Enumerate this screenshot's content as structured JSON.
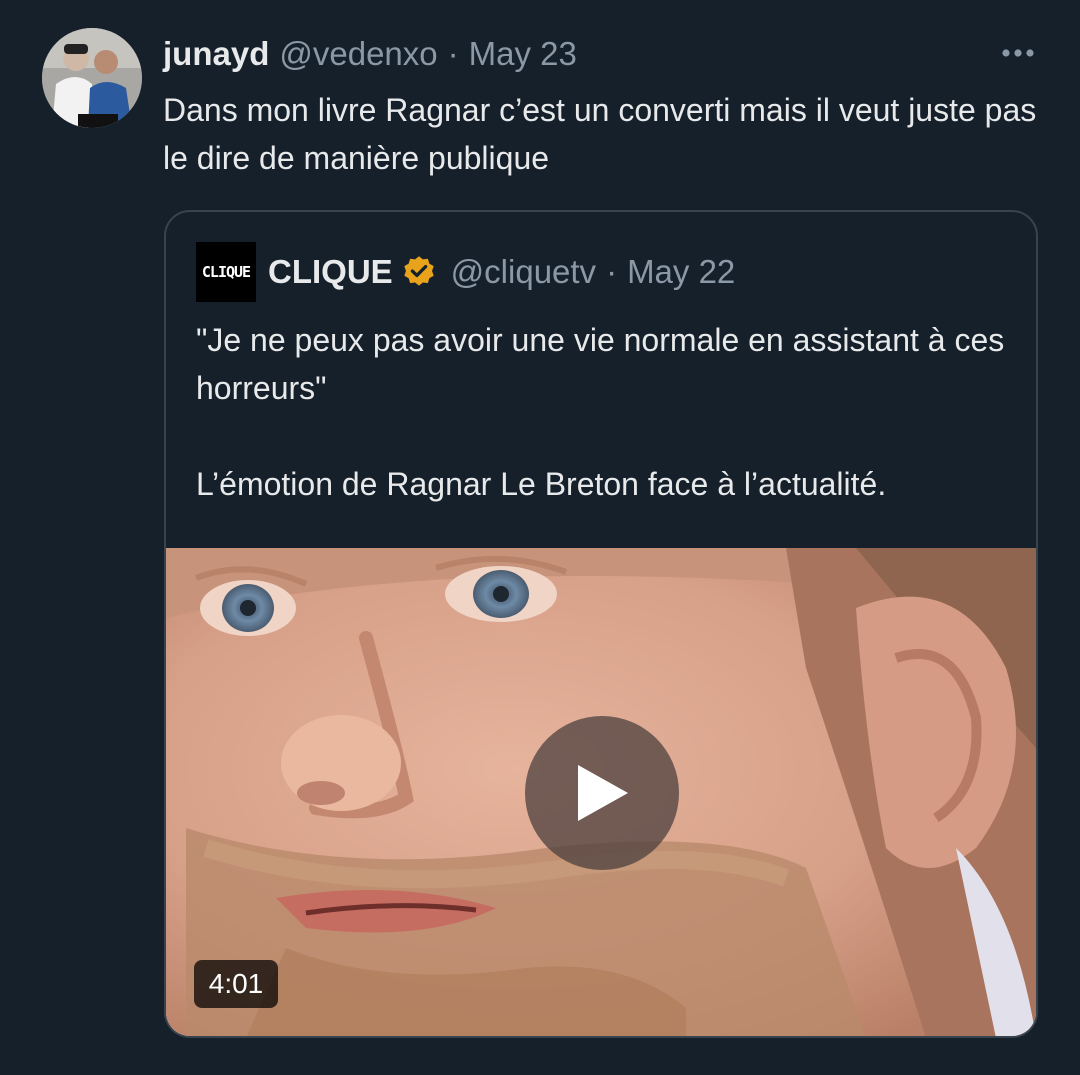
{
  "tweet": {
    "author_name": "junayd",
    "author_handle": "@vedenxo",
    "separator": "·",
    "date": "May 23",
    "text": "Dans mon livre Ragnar c’est un converti mais il veut juste pas le dire de manière publique",
    "more_icon": "more-horizontal-icon"
  },
  "quoted": {
    "logo_text": "CLIQUE",
    "name": "CLIQUE",
    "verified_icon": "verified-badge-icon",
    "verified_color": "#e8a21c",
    "handle": "@cliquetv",
    "separator": "·",
    "date": "May 22",
    "text_line1": "\"Je ne peux pas avoir une vie normale en assistant à ces horreurs\"",
    "text_line2": "L’émotion de Ragnar Le Breton face à l’actualité.",
    "video": {
      "duration": "4:01",
      "play_icon": "play-icon"
    }
  },
  "colors": {
    "background": "#15202b",
    "text_primary": "#e7e9ea",
    "text_secondary": "#8b98a5",
    "border": "#38444d"
  }
}
